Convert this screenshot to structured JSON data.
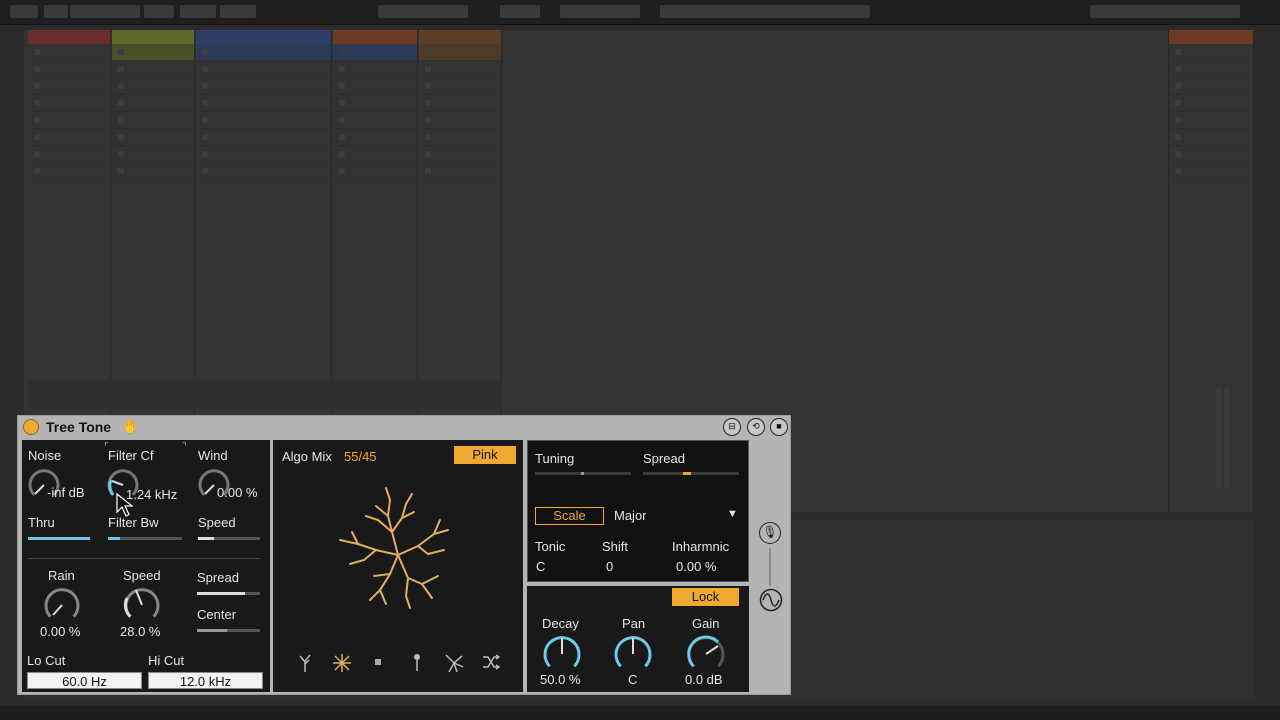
{
  "device": {
    "name": "Tree Tone",
    "noise": {
      "label": "Noise",
      "value": "-inf dB"
    },
    "filter_cf": {
      "label": "Filter Cf",
      "value": "1.24 kHz"
    },
    "wind": {
      "label": "Wind",
      "value": "0.00 %"
    },
    "thru": {
      "label": "Thru"
    },
    "filter_bw": {
      "label": "Filter Bw"
    },
    "speed_top": {
      "label": "Speed"
    },
    "rain": {
      "label": "Rain",
      "value": "0.00 %"
    },
    "speed": {
      "label": "Speed",
      "value": "28.0 %"
    },
    "spread": {
      "label": "Spread"
    },
    "center": {
      "label": "Center"
    },
    "lo_cut": {
      "label": "Lo Cut",
      "value": "60.0 Hz"
    },
    "hi_cut": {
      "label": "Hi Cut",
      "value": "12.0 kHz"
    },
    "algo": {
      "label": "Algo Mix",
      "value": "55/45",
      "pink_label": "Pink"
    },
    "tuning": {
      "label": "Tuning",
      "spread_label": "Spread"
    },
    "scale": {
      "button": "Scale",
      "value": "Major"
    },
    "tonic": {
      "label": "Tonic",
      "value": "C"
    },
    "shift": {
      "label": "Shift",
      "value": "0"
    },
    "inharmonic": {
      "label": "Inharmnic",
      "value": "0.00 %"
    },
    "lock_label": "Lock",
    "decay": {
      "label": "Decay",
      "value": "50.0 %"
    },
    "pan": {
      "label": "Pan",
      "value": "C"
    },
    "gain": {
      "label": "Gain",
      "value": "0.0 dB"
    }
  },
  "accent_color": "#f0a830",
  "knob_color": "#6ec9e6",
  "icons": [
    "power-icon",
    "hand-icon",
    "tree-icon",
    "branch-icon",
    "dot-icon",
    "pin-icon",
    "burst-icon",
    "shuffle-icon",
    "mic-icon",
    "sine-icon"
  ]
}
